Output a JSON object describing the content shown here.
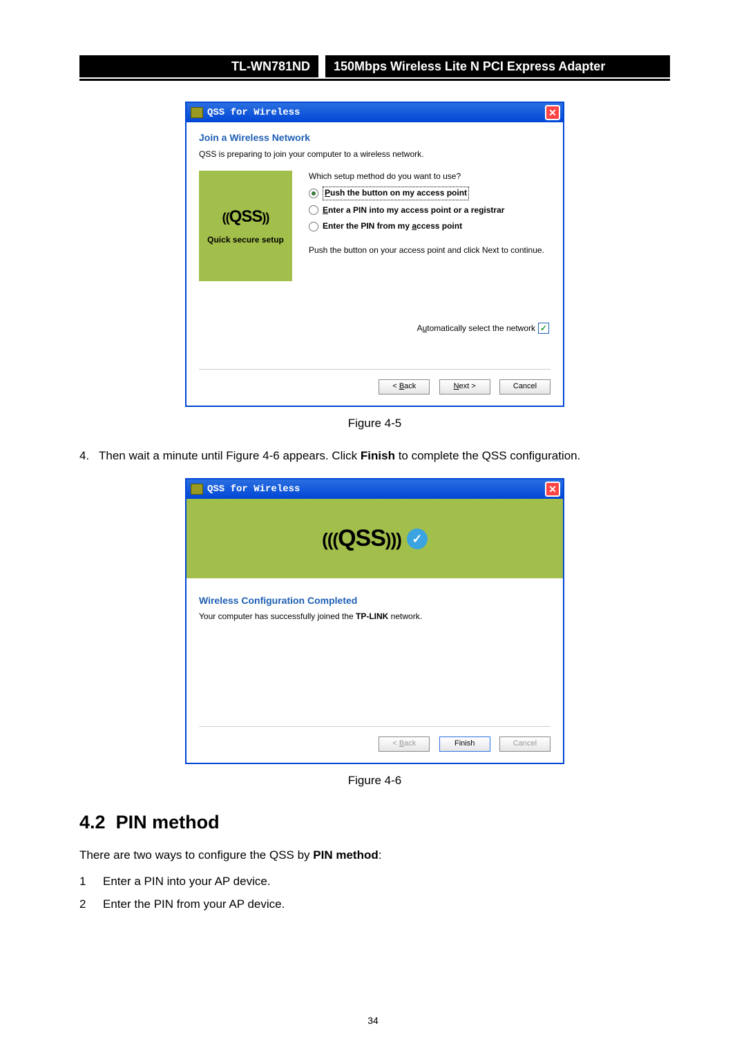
{
  "header": {
    "model": "TL-WN781ND",
    "product": "150Mbps Wireless Lite N PCI Express Adapter"
  },
  "dialog1": {
    "title": "QSS for Wireless",
    "heading": "Join a Wireless Network",
    "sub": "QSS is preparing to join your computer to a wireless network.",
    "logo_caption": "Quick secure setup",
    "prompt": "Which setup method do you want to use?",
    "radios": {
      "r1": "Push the button on my access point",
      "r2": "Enter a PIN into my access point or a registrar",
      "r3": "Enter the PIN from my access point"
    },
    "instr": "Push the button on your access point and click Next to continue.",
    "auto": "Automatically select the network",
    "btns": {
      "back": "< Back",
      "next": "Next >",
      "cancel": "Cancel"
    }
  },
  "caption1": "Figure 4-5",
  "step4": {
    "num": "4.",
    "t1": "Then wait a minute until Figure 4-6 appears. Click ",
    "bold": "Finish",
    "t2": " to complete the QSS configuration."
  },
  "dialog2": {
    "title": "QSS for Wireless",
    "heading": "Wireless Configuration Completed",
    "msg_a": "Your computer has successfully joined the ",
    "msg_b": "TP-LINK",
    "msg_c": " network.",
    "btns": {
      "back": "< Back",
      "finish": "Finish",
      "cancel": "Cancel"
    }
  },
  "caption2": "Figure 4-6",
  "sec": {
    "num": "4.2",
    "title": "PIN method"
  },
  "intro_a": "There are two ways to configure the QSS by ",
  "intro_b": "PIN method",
  "intro_c": ":",
  "l1n": "1",
  "l1": "Enter a PIN into your AP device.",
  "l2n": "2",
  "l2": "Enter the PIN from your AP device.",
  "page_number": "34"
}
